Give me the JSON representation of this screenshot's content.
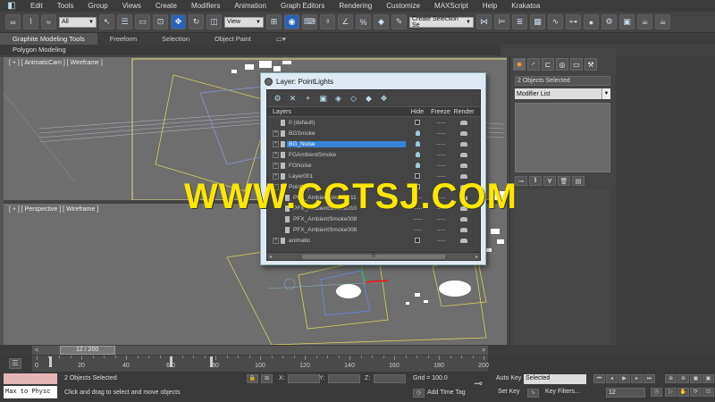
{
  "menubar": {
    "items": [
      "Edit",
      "Tools",
      "Group",
      "Views",
      "Create",
      "Modifiers",
      "Animation",
      "Graph Editors",
      "Rendering",
      "Customize",
      "MAXScript",
      "Help",
      "Krakatoa"
    ]
  },
  "toolbar": {
    "filter_select": "All",
    "refcoord_select": "View",
    "selection_set": "Create Selection Se"
  },
  "ribbon": {
    "tabs": [
      "Graphite Modeling Tools",
      "Freeform",
      "Selection",
      "Object Paint"
    ],
    "subtab": "Polygon Modeling"
  },
  "viewports": {
    "top_label": "[ + ] [ AnimaticCam ] [ Wireframe ]",
    "persp_label": "[ + ] [ Perspective ] [ Wireframe ]"
  },
  "command_panel": {
    "selection_name": "2 Objects Selected",
    "modifier_list": "Modifier List"
  },
  "layer_dialog": {
    "title": "Layer: PointLights",
    "columns": {
      "name": "Layers",
      "hide": "Hide",
      "freeze": "Freeze",
      "render": "Render"
    },
    "rows": [
      {
        "name": "0 (default)",
        "indent": 0,
        "expander": "",
        "selected": false,
        "hide": "check"
      },
      {
        "name": "BGSmoke",
        "indent": 0,
        "expander": "+",
        "selected": false,
        "hide": "bulb"
      },
      {
        "name": "BG_Noise",
        "indent": 0,
        "expander": "+",
        "selected": true,
        "hide": "bulb"
      },
      {
        "name": "FGAmbientSmoke",
        "indent": 0,
        "expander": "+",
        "selected": false,
        "hide": "bulb"
      },
      {
        "name": "FGNoise",
        "indent": 0,
        "expander": "+",
        "selected": false,
        "hide": "bulb"
      },
      {
        "name": "Layer001",
        "indent": 0,
        "expander": "+",
        "selected": false,
        "hide": "check"
      },
      {
        "name": "PointLights",
        "indent": 0,
        "expander": "-",
        "selected": false,
        "hide": "check"
      },
      {
        "name": "PFX_AmbientSmoke011",
        "indent": 1,
        "expander": "",
        "selected": false,
        "hide": "dots"
      },
      {
        "name": "PFX_AmbientSmoke010",
        "indent": 1,
        "expander": "",
        "selected": false,
        "hide": "dots"
      },
      {
        "name": "PFX_AmbientSmoke009",
        "indent": 1,
        "expander": "",
        "selected": false,
        "hide": "dots"
      },
      {
        "name": "PFX_AmbientSmoke008",
        "indent": 1,
        "expander": "",
        "selected": false,
        "hide": "dots"
      },
      {
        "name": "animatic",
        "indent": 0,
        "expander": "+",
        "selected": false,
        "hide": "check"
      }
    ],
    "scroll_mark": "III"
  },
  "watermark": "WWW.CGTSJ.COM",
  "timeslider": {
    "frame_display": "12 / 200",
    "prev": "<",
    "next": ">",
    "position": 0.06
  },
  "trackbar": {
    "ticks": [
      0,
      20,
      40,
      60,
      80,
      100,
      120,
      140,
      160,
      180,
      200
    ],
    "tick_labels": [
      "0",
      "20",
      "40",
      "6 0",
      "80",
      "100",
      "120",
      "140",
      "160",
      "180",
      "200"
    ],
    "keys": [
      6,
      60,
      78
    ]
  },
  "statusbar": {
    "maxscript_text": "Max to Physc",
    "objects_selected": "2 Objects Selected",
    "prompt": "Click and drag to select and move objects",
    "x_label": "X:",
    "y_label": "Y:",
    "z_label": "Z:",
    "grid": "Grid = 100.0",
    "add_time_tag": "Add Time Tag",
    "auto_key": "Auto Key",
    "set_key": "Set Key",
    "selected_dd": "Selected",
    "key_filters": "Key Filters...",
    "frame": "12"
  }
}
